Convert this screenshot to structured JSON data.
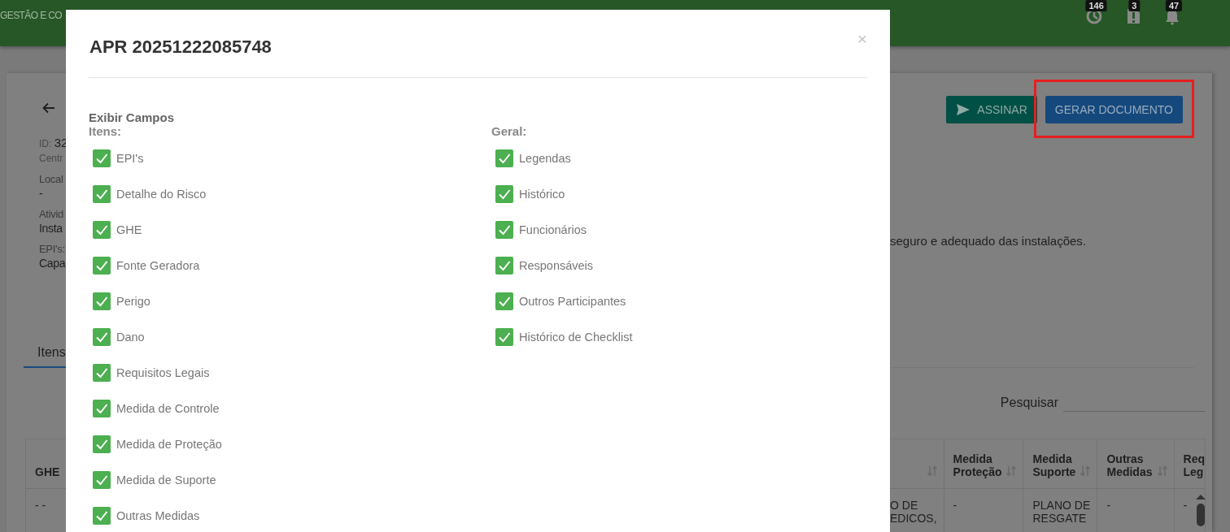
{
  "header": {
    "title": "GESTÃO E CO",
    "notifications": [
      {
        "kind": "clock",
        "count": "146"
      },
      {
        "kind": "alert",
        "count": "3"
      },
      {
        "kind": "bell",
        "count": "47"
      }
    ]
  },
  "record": {
    "fields": [
      {
        "label": "ID:",
        "value": "32"
      },
      {
        "label": "Centr"
      },
      {
        "label": "Local",
        "value": "-"
      },
      {
        "label": "Ativid",
        "value": "Insta"
      },
      {
        "label": "EPI's:",
        "value": "Capa"
      }
    ],
    "actions": [
      {
        "kind": "sign",
        "label": "ASSINAR",
        "highlighted": false
      },
      {
        "kind": "generate",
        "label": "GERAR DOCUMENTO",
        "highlighted": true
      }
    ],
    "description": "seguro e adequado das instalações.",
    "tabs": [
      {
        "label": "Itens",
        "selected": true
      }
    ],
    "search": {
      "label": "Pesquisar"
    },
    "table": {
      "columns": [
        {
          "label": "GHE",
          "sortable": false
        },
        {
          "sortable": true
        },
        {
          "label": "Medida Proteção",
          "sortable": true
        },
        {
          "label": "Medida Suporte",
          "sortable": true
        },
        {
          "label": "Outras Medidas",
          "sortable": true
        },
        {
          "label": "Req Leg",
          "sortable": false
        }
      ],
      "rows": [
        {
          "cells": [
            "- -",
            "O DE EDICOS,",
            "-",
            "PLANO DE RESGATE",
            "-",
            "-"
          ]
        }
      ]
    }
  },
  "modal": {
    "title": "APR 20251222085748",
    "close": "×",
    "section": "Exibir Campos",
    "groups": [
      {
        "title": "Itens:",
        "options": [
          {
            "label": "EPI's",
            "checked": true
          },
          {
            "label": "Detalhe do Risco",
            "checked": true
          },
          {
            "label": "GHE",
            "checked": true
          },
          {
            "label": "Fonte Geradora",
            "checked": true
          },
          {
            "label": "Perigo",
            "checked": true
          },
          {
            "label": "Dano",
            "checked": true
          },
          {
            "label": "Requisitos Legais",
            "checked": true
          },
          {
            "label": "Medida de Controle",
            "checked": true
          },
          {
            "label": "Medida de Proteção",
            "checked": true
          },
          {
            "label": "Medida de Suporte",
            "checked": true
          },
          {
            "label": "Outras Medidas",
            "checked": true
          }
        ]
      },
      {
        "title": "Geral:",
        "options": [
          {
            "label": "Legendas",
            "checked": true
          },
          {
            "label": "Histórico",
            "checked": true
          },
          {
            "label": "Funcionários",
            "checked": true
          },
          {
            "label": "Responsáveis",
            "checked": true
          },
          {
            "label": "Outros Participantes",
            "checked": true
          },
          {
            "label": "Histórico de Checklist",
            "checked": true
          }
        ]
      }
    ]
  }
}
